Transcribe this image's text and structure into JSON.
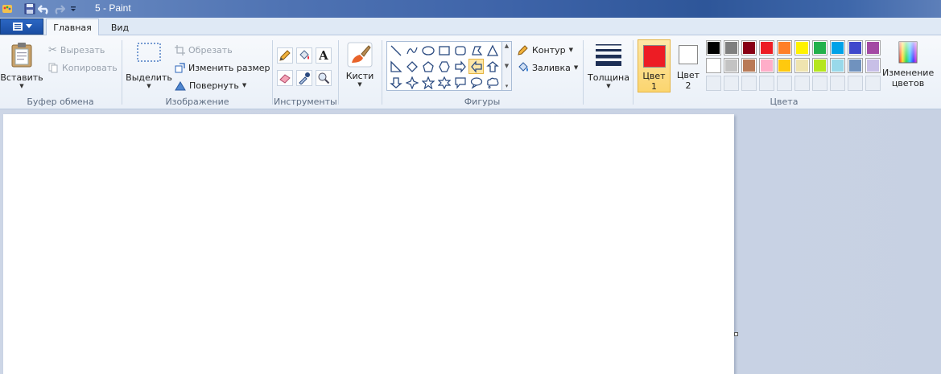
{
  "window": {
    "title": "5 - Paint"
  },
  "tabs": {
    "home": "Главная",
    "view": "Вид"
  },
  "clipboard": {
    "label": "Буфер обмена",
    "paste": "Вставить",
    "cut": "Вырезать",
    "copy": "Копировать"
  },
  "image": {
    "label": "Изображение",
    "select": "Выделить",
    "crop": "Обрезать",
    "resize": "Изменить размер",
    "rotate": "Повернуть"
  },
  "tools": {
    "label": "Инструменты"
  },
  "brushes": {
    "label": "Кисти"
  },
  "shapes": {
    "label": "Фигуры",
    "outline": "Контур",
    "fill": "Заливка"
  },
  "size": {
    "label": "Толщина"
  },
  "colors": {
    "label": "Цвета",
    "color1_line1": "Цвет",
    "color1_line2": "1",
    "color2_line1": "Цвет",
    "color2_line2": "2",
    "edit_line1": "Изменение",
    "edit_line2": "цветов",
    "color1_value": "#ed1c24",
    "color2_value": "#ffffff",
    "palette_row1": [
      "#000000",
      "#7f7f7f",
      "#880015",
      "#ed1c24",
      "#ff7f27",
      "#fff200",
      "#22b14c",
      "#00a2e8",
      "#3f48cc",
      "#a349a4"
    ],
    "palette_row2": [
      "#ffffff",
      "#c3c3c3",
      "#b97a57",
      "#ffaec9",
      "#ffc90e",
      "#efe4b0",
      "#b5e61d",
      "#99d9ea",
      "#7092be",
      "#c8bfe7"
    ]
  },
  "icons": {
    "qat": [
      "paint-app-icon",
      "save-icon",
      "undo-icon",
      "redo-icon",
      "customize-qat-icon"
    ]
  }
}
